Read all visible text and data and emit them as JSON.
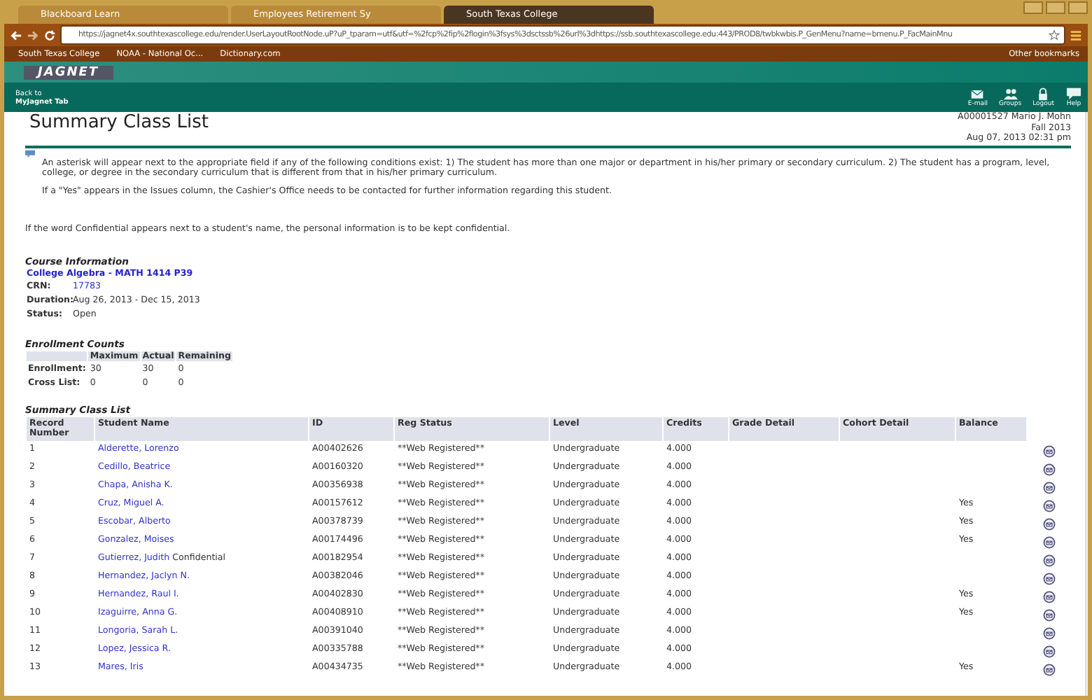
{
  "browser": {
    "tabs": [
      {
        "title": "Blackboard Learn",
        "selected": false
      },
      {
        "title": "Employees Retirement Sy",
        "selected": false
      },
      {
        "title": "South Texas College",
        "selected": true
      }
    ],
    "url": "https://jagnet4x.southtexascollege.edu/render.UserLayoutRootNode.uP?uP_tparam=utf&utf=%2fcp%2fip%2flogin%3fsys%3dsctssb%26url%3dhttps://ssb.southtexascollege.edu:443/PROD8/twbkwbis.P_GenMenu?name=bmenu.P_FacMainMnu",
    "bookmarks": [
      "South Texas College",
      "NOAA - National Oc...",
      "Dictionary.com"
    ],
    "other_bookmarks": "Other bookmarks"
  },
  "portal": {
    "logo": "JAGNET",
    "back_link": [
      "Back to",
      "MyJagnet Tab"
    ],
    "tools": [
      {
        "label": "E-mail",
        "kind": "email"
      },
      {
        "label": "Groups",
        "kind": "groups"
      },
      {
        "label": "Logout",
        "kind": "logout"
      },
      {
        "label": "Help",
        "kind": "help"
      }
    ]
  },
  "page": {
    "title": "Summary Class List",
    "user": "A00001527 Mario J. Mohn",
    "term": "Fall 2013",
    "timestamp": "Aug 07, 2013 02:31 pm",
    "notes": [
      "An asterisk will appear next to the appropriate field if any of the following conditions exist: 1) The student has more than one major or department in his/her primary or secondary curriculum. 2) The student has a program, level, college, or degree in the secondary curriculum that is different from that in his/her primary curriculum.",
      "If a \"Yes\" appears in the Issues column, the Cashier's Office needs to be contacted for further information regarding this student."
    ],
    "confidential_note": "If the word Confidential appears next to a student's name, the personal information is to be kept confidential."
  },
  "course": {
    "heading": "Course Information",
    "name": "College Algebra - MATH 1414 P39",
    "fields": [
      {
        "label": "CRN:",
        "value": "17783",
        "link": true
      },
      {
        "label": "Duration:",
        "value": "Aug 26, 2013 - Dec 15, 2013",
        "link": false
      },
      {
        "label": "Status:",
        "value": "Open",
        "link": false
      }
    ]
  },
  "enrollment": {
    "heading": "Enrollment Counts",
    "columns": [
      "Maximum",
      "Actual",
      "Remaining"
    ],
    "rows": [
      {
        "label": "Enrollment:",
        "values": [
          "30",
          "30",
          "0"
        ]
      },
      {
        "label": "Cross List:",
        "values": [
          "0",
          "0",
          "0"
        ]
      }
    ]
  },
  "class_list": {
    "heading": "Summary Class List",
    "columns": [
      "Record Number",
      "Student Name",
      "ID",
      "Reg Status",
      "Level",
      "Credits",
      "Grade Detail",
      "Cohort Detail",
      "Balance"
    ],
    "rows": [
      {
        "record": "1",
        "name": "Alderette, Lorenzo",
        "id": "A00402626",
        "reg_status": "**Web Registered**",
        "level": "Undergraduate",
        "credits": "4.000"
      },
      {
        "record": "2",
        "name": "Cedillo, Beatrice",
        "id": "A00160320",
        "reg_status": "**Web Registered**",
        "level": "Undergraduate",
        "credits": "4.000"
      },
      {
        "record": "3",
        "name": "Chapa, Anisha K.",
        "id": "A00356938",
        "reg_status": "**Web Registered**",
        "level": "Undergraduate",
        "credits": "4.000"
      },
      {
        "record": "4",
        "name": "Cruz, Miguel A.",
        "id": "A00157612",
        "reg_status": "**Web Registered**",
        "level": "Undergraduate",
        "credits": "4.000",
        "balance": "Yes"
      },
      {
        "record": "5",
        "name": "Escobar, Alberto",
        "id": "A00378739",
        "reg_status": "**Web Registered**",
        "level": "Undergraduate",
        "credits": "4.000",
        "balance": "Yes"
      },
      {
        "record": "6",
        "name": "Gonzalez, Moises",
        "id": "A00174496",
        "reg_status": "**Web Registered**",
        "level": "Undergraduate",
        "credits": "4.000",
        "balance": "Yes"
      },
      {
        "record": "7",
        "name": "Gutierrez, Judith",
        "note": "Confidential",
        "id": "A00182954",
        "reg_status": "**Web Registered**",
        "level": "Undergraduate",
        "credits": "4.000"
      },
      {
        "record": "8",
        "name": "Hernandez, Jaclyn N.",
        "id": "A00382046",
        "reg_status": "**Web Registered**",
        "level": "Undergraduate",
        "credits": "4.000"
      },
      {
        "record": "9",
        "name": "Hernandez, Raul I.",
        "id": "A00402830",
        "reg_status": "**Web Registered**",
        "level": "Undergraduate",
        "credits": "4.000",
        "balance": "Yes"
      },
      {
        "record": "10",
        "name": "Izaguirre, Anna G.",
        "id": "A00408910",
        "reg_status": "**Web Registered**",
        "level": "Undergraduate",
        "credits": "4.000",
        "balance": "Yes"
      },
      {
        "record": "11",
        "name": "Longoria, Sarah L.",
        "id": "A00391040",
        "reg_status": "**Web Registered**",
        "level": "Undergraduate",
        "credits": "4.000"
      },
      {
        "record": "12",
        "name": "Lopez, Jessica R.",
        "id": "A00335788",
        "reg_status": "**Web Registered**",
        "level": "Undergraduate",
        "credits": "4.000"
      },
      {
        "record": "13",
        "name": "Mares, Iris",
        "id": "A00434735",
        "reg_status": "**Web Registered**",
        "level": "Undergraduate",
        "credits": "4.000",
        "balance": "Yes"
      }
    ]
  }
}
